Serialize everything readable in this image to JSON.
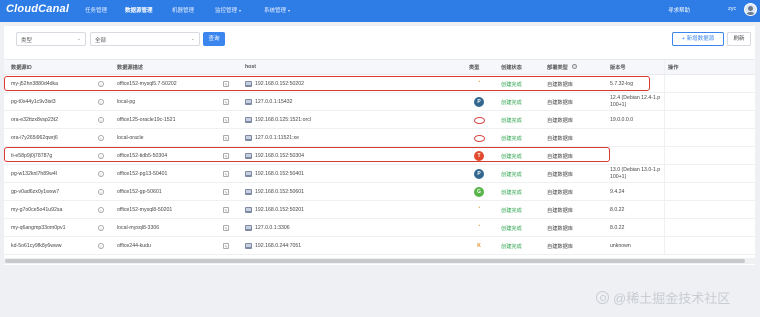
{
  "app": {
    "logo": "CloudCanal"
  },
  "nav": {
    "items": [
      {
        "label": "任务管理",
        "active": false,
        "has_caret": false
      },
      {
        "label": "数据源管理",
        "active": true,
        "has_caret": false
      },
      {
        "label": "机器管理",
        "active": false,
        "has_caret": false
      },
      {
        "label": "监控管理",
        "active": false,
        "has_caret": true
      },
      {
        "label": "系统管理",
        "active": false,
        "has_caret": true
      }
    ],
    "help": "寻求帮助",
    "user": "zyc"
  },
  "filters": {
    "type_placeholder": "类型",
    "scope_value": "全部",
    "query_label": "查询",
    "add_label": "+ 新增数据源",
    "refresh_label": "刷新"
  },
  "table": {
    "headers": {
      "id": "数据源ID",
      "desc": "数据源描述",
      "host": "host",
      "type": "类型",
      "status": "创建状态",
      "deploy": "部署类型",
      "version": "版本号",
      "op": "操作"
    },
    "rows": [
      {
        "id": "my-j52hn3880d4dka",
        "desc": "office152-mysql5.7-50202",
        "host": "192.168.0.152:50202",
        "type": "mysql",
        "status": "创建完成",
        "deploy": "自建数据库",
        "version": [
          "5.7.32-log"
        ]
      },
      {
        "id": "pg-t0x44y1c9v3ist3",
        "desc": "local-pg",
        "host": "127.0.0.1:15432",
        "type": "pg",
        "status": "创建完成",
        "deploy": "自建数据库",
        "version": [
          "12.4 (Debian 12.4-1.p",
          "100+1)"
        ]
      },
      {
        "id": "ora-e32ttzx8vsp23t2",
        "desc": "office125-oracle19c-1521",
        "host": "192.168.0.125:1521:orcl",
        "type": "oracle",
        "status": "创建完成",
        "deploy": "自建数据库",
        "version": [
          "19.0.0.0.0"
        ]
      },
      {
        "id": "ora-i7y265i962qwrj6",
        "desc": "local-oracle",
        "host": "127.0.0.1:11521:xe",
        "type": "oracle",
        "status": "创建完成",
        "deploy": "自建数据库",
        "version": [
          ""
        ]
      },
      {
        "id": "ti-e58p9j0j78787g",
        "desc": "office152-tidb5-50304",
        "host": "192.168.0.152:50304",
        "type": "tidb",
        "status": "创建完成",
        "deploy": "自建数据库",
        "version": [
          ""
        ]
      },
      {
        "id": "pg-w132knl7h89w4l",
        "desc": "office152-pg13-50401",
        "host": "192.168.0.152:50401",
        "type": "pg",
        "status": "创建完成",
        "deploy": "自建数据库",
        "version": [
          "13.0 (Debian 13.0-1.p",
          "100+1)"
        ]
      },
      {
        "id": "gp-v0ad6zx0y1wxw7",
        "desc": "office152-gp-50601",
        "host": "192.168.0.152:50601",
        "type": "gp",
        "status": "创建完成",
        "deploy": "自建数据库",
        "version": [
          "9.4.24"
        ]
      },
      {
        "id": "my-g7o0ce5o41u92sa",
        "desc": "office152-mysql8-50201",
        "host": "192.168.0.152:50201",
        "type": "mysql",
        "status": "创建完成",
        "deploy": "自建数据库",
        "version": [
          "8.0.22"
        ]
      },
      {
        "id": "my-q6angmp33om0pv1",
        "desc": "local-mysql8-3306",
        "host": "127.0.0.1:3306",
        "type": "mysql",
        "status": "创建完成",
        "deploy": "自建数据库",
        "version": [
          "8.0.22"
        ]
      },
      {
        "id": "kd-5o61cy9fk8y6www",
        "desc": "office244-kudu",
        "host": "192.168.0.244:7051",
        "type": "kudu",
        "status": "创建完成",
        "deploy": "自建数据库",
        "version": [
          "unknown"
        ]
      }
    ]
  },
  "watermark": "@稀土掘金技术社区",
  "colors": {
    "nav_bg": "#2e7ce6",
    "primary": "#3a86ee",
    "success": "#2ea44f",
    "highlight": "#d93a32"
  }
}
